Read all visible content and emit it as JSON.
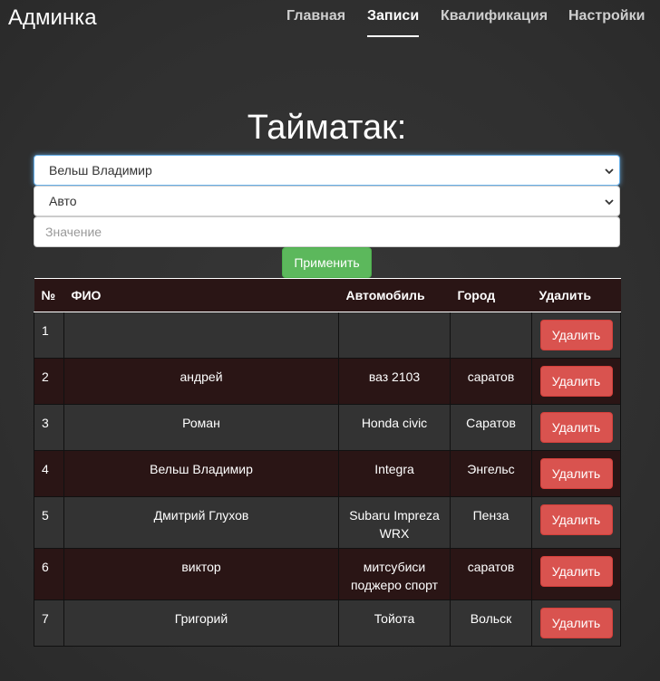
{
  "navbar": {
    "brand": "Админка",
    "items": [
      {
        "label": "Главная",
        "active": false
      },
      {
        "label": "Записи",
        "active": true
      },
      {
        "label": "Квалификация",
        "active": false
      },
      {
        "label": "Настройки",
        "active": false
      }
    ]
  },
  "main": {
    "title": "Тайматак:",
    "pilot_select": {
      "value": "Вельш Владимир"
    },
    "field_select": {
      "value": "Авто"
    },
    "value_input": {
      "placeholder": "Значение",
      "value": ""
    },
    "apply_label": "Применить"
  },
  "table": {
    "headers": {
      "number": "№",
      "name": "ФИО",
      "car": "Автомобиль",
      "city": "Город",
      "delete": "Удалить"
    },
    "rows": [
      {
        "number": "1",
        "name": "",
        "car": "",
        "city": "",
        "delete_label": "Удалить"
      },
      {
        "number": "2",
        "name": "андрей",
        "car": "ваз 2103",
        "city": "саратов",
        "delete_label": "Удалить"
      },
      {
        "number": "3",
        "name": "Роман",
        "car": "Honda civic",
        "city": "Саратов",
        "delete_label": "Удалить"
      },
      {
        "number": "4",
        "name": "Вельш Владимир",
        "car": "Integra",
        "city": "Энгельс",
        "delete_label": "Удалить"
      },
      {
        "number": "5",
        "name": "Дмитрий Глухов",
        "car": "Subaru Impreza WRX",
        "city": "Пенза",
        "delete_label": "Удалить"
      },
      {
        "number": "6",
        "name": "виктор",
        "car": "митсубиси поджеро спорт",
        "city": "саратов",
        "delete_label": "Удалить"
      },
      {
        "number": "7",
        "name": "Григорий",
        "car": "Тойота",
        "city": "Вольск",
        "delete_label": "Удалить"
      }
    ]
  },
  "colors": {
    "background": "#333333",
    "table_dark_row": "#2a1515",
    "apply_button": "#5cb85c",
    "delete_button": "#d9534f",
    "focus_ring": "#66afe9"
  },
  "icons": [
    "chevron-down-icon"
  ]
}
